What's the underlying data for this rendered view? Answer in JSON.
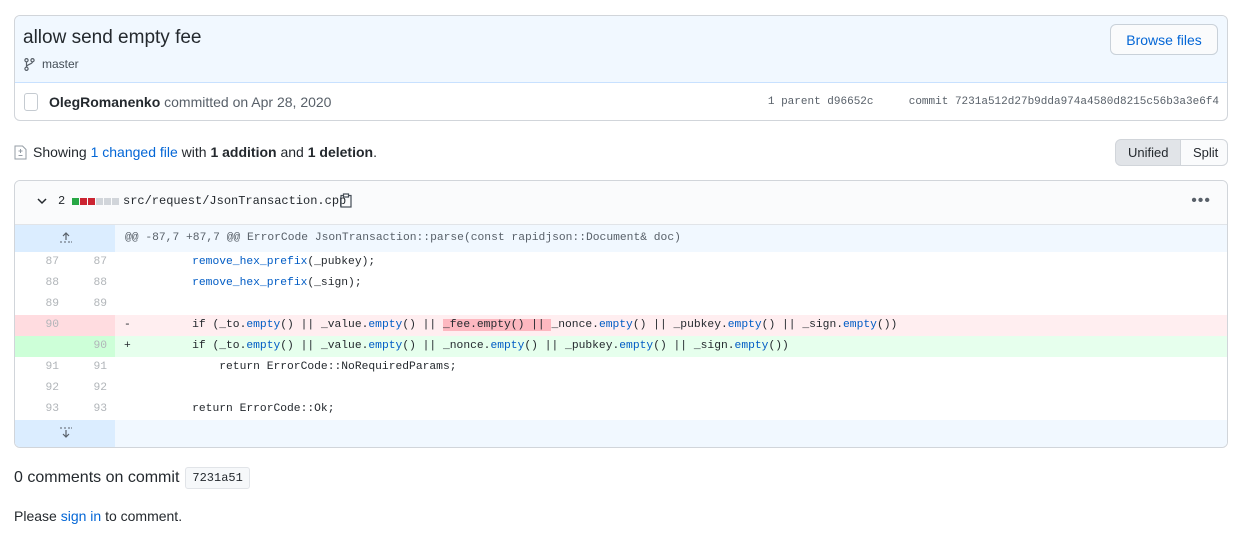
{
  "commit": {
    "title": "allow send empty fee",
    "branch": "master",
    "browse_label": "Browse files",
    "author": "OlegRomanenko",
    "committed_text": "committed on Apr 28, 2020",
    "parent_label": "1 parent",
    "parent_sha": "d96652c",
    "commit_label": "commit",
    "commit_sha": "7231a512d27b9dda974a4580d8215c56b3a3e6f4"
  },
  "toolbar": {
    "showing": "Showing",
    "changed_files": "1 changed file",
    "with": "with",
    "additions": "1 addition",
    "and": "and",
    "deletions": "1 deletion",
    "period": ".",
    "unified_label": "Unified",
    "split_label": "Split"
  },
  "file": {
    "change_count": "2",
    "path": "src/request/JsonTransaction.cpp",
    "hunk_header": "@@ -87,7 +87,7 @@ ErrorCode JsonTransaction::parse(const rapidjson::Document& doc)",
    "diffstat_colors": [
      "#28a745",
      "#cb2431",
      "#cb2431",
      "#d1d5da",
      "#d1d5da",
      "#d1d5da"
    ]
  },
  "diff_lines": [
    {
      "old": "87",
      "new": "87",
      "type": "ctx",
      "sign": "",
      "parts": [
        [
          "",
          "    "
        ],
        [
          "f",
          "remove_hex_prefix"
        ],
        [
          "",
          "(_pubkey);"
        ]
      ]
    },
    {
      "old": "88",
      "new": "88",
      "type": "ctx",
      "sign": "",
      "parts": [
        [
          "",
          "    "
        ],
        [
          "f",
          "remove_hex_prefix"
        ],
        [
          "",
          "(_sign);"
        ]
      ]
    },
    {
      "old": "89",
      "new": "89",
      "type": "ctx",
      "sign": "",
      "parts": [
        [
          "",
          ""
        ]
      ]
    },
    {
      "old": "90",
      "new": "",
      "type": "del",
      "sign": "-",
      "parts": [
        [
          "",
          "    if (_to."
        ],
        [
          "f",
          "empty"
        ],
        [
          "",
          "() || _value."
        ],
        [
          "f",
          "empty"
        ],
        [
          "",
          "() || "
        ],
        [
          "h",
          "_fee.empty() || "
        ],
        [
          "",
          "_nonce."
        ],
        [
          "f",
          "empty"
        ],
        [
          "",
          "() || _pubkey."
        ],
        [
          "f",
          "empty"
        ],
        [
          "",
          "() || _sign."
        ],
        [
          "f",
          "empty"
        ],
        [
          "",
          "())"
        ]
      ]
    },
    {
      "old": "",
      "new": "90",
      "type": "add",
      "sign": "+",
      "parts": [
        [
          "",
          "    if (_to."
        ],
        [
          "f",
          "empty"
        ],
        [
          "",
          "() || _value."
        ],
        [
          "f",
          "empty"
        ],
        [
          "",
          "() || _nonce."
        ],
        [
          "f",
          "empty"
        ],
        [
          "",
          "() || _pubkey."
        ],
        [
          "f",
          "empty"
        ],
        [
          "",
          "() || _sign."
        ],
        [
          "f",
          "empty"
        ],
        [
          "",
          "())"
        ]
      ]
    },
    {
      "old": "91",
      "new": "91",
      "type": "ctx",
      "sign": "",
      "parts": [
        [
          "",
          "        return ErrorCode::NoRequiredParams;"
        ]
      ]
    },
    {
      "old": "92",
      "new": "92",
      "type": "ctx",
      "sign": "",
      "parts": [
        [
          "",
          ""
        ]
      ]
    },
    {
      "old": "93",
      "new": "93",
      "type": "ctx",
      "sign": "",
      "parts": [
        [
          "",
          "    return ErrorCode::Ok;"
        ]
      ]
    }
  ],
  "comments": {
    "title": "0 comments on commit",
    "short_sha": "7231a51",
    "please": "Please",
    "sign_in": "sign in",
    "to_comment": "to comment."
  }
}
